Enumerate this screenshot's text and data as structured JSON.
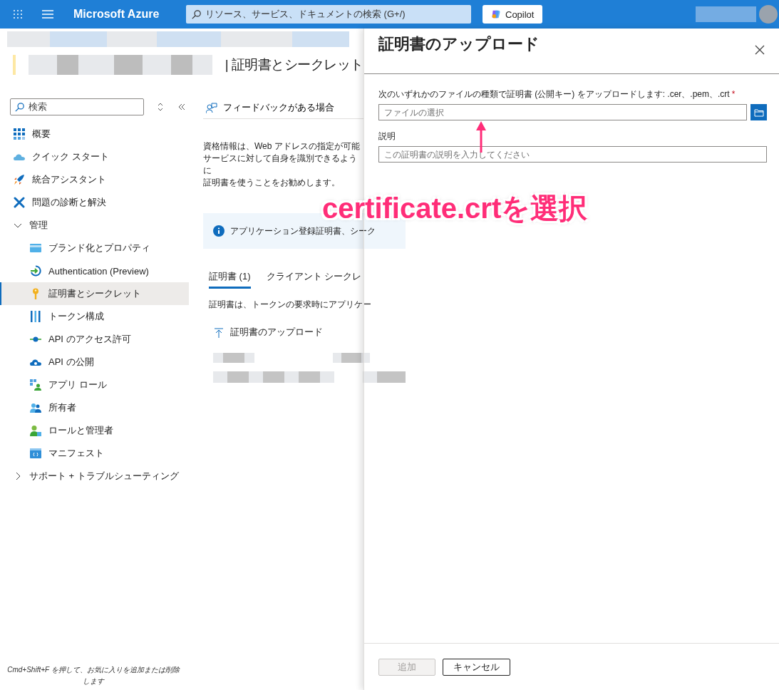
{
  "top_bar": {
    "title": "Microsoft Azure",
    "search": {
      "placeholder": "リソース、サービス、ドキュメントの検索 (G+/)"
    },
    "copilot_button": "Copilot"
  },
  "page": {
    "title": "| 証明書とシークレット",
    "sidebar": {
      "search": {
        "placeholder": "検索"
      },
      "items": [
        {
          "label": "概要",
          "selected": false
        },
        {
          "label": "クイック スタート",
          "selected": false
        },
        {
          "label": "統合アシスタント",
          "selected": false
        },
        {
          "label": "問題の診断と解決",
          "selected": false
        },
        {
          "label": "管理",
          "selected": false,
          "expanded": true,
          "children": [
            {
              "label": "ブランド化とプロパティ",
              "selected": false
            },
            {
              "label": "Authentication (Preview)",
              "selected": false
            },
            {
              "label": "証明書とシークレット",
              "selected": true
            },
            {
              "label": "トークン構成",
              "selected": false
            },
            {
              "label": "API のアクセス許可",
              "selected": false
            },
            {
              "label": "API の公開",
              "selected": false
            },
            {
              "label": "アプリ ロール",
              "selected": false
            },
            {
              "label": "所有者",
              "selected": false
            },
            {
              "label": "ロールと管理者",
              "selected": false
            },
            {
              "label": "マニフェスト",
              "selected": false
            }
          ]
        },
        {
          "label": "サポート + トラブルシューティング",
          "selected": false,
          "expanded": false
        }
      ],
      "hint": "Cmd+Shift+F を押して、お気に入りを追加または削除します"
    },
    "feedback": "フィードバックがある場合",
    "description": [
      "資格情報は、Web アドレスの指定が可能",
      "サービスに対して自身を識別できるように",
      "証明書を使うことをお勧めします。"
    ],
    "info": "アプリケーション登録証明書、シーク",
    "tabs": [
      {
        "label": "証明書 (1)",
        "selected": true
      },
      {
        "label": "クライアント シークレ",
        "selected": false
      }
    ],
    "tab_description": "証明書は、トークンの要求時にアプリケー",
    "upload_button": "証明書のアップロード"
  },
  "blade": {
    "title": "証明書のアップロード",
    "file_field": {
      "label": "次のいずれかのファイルの種類で証明書 (公開キー) をアップロードします: .cer、.pem、.crt",
      "required_mark": "*",
      "placeholder": "ファイルの選択"
    },
    "description_field": {
      "label": "説明",
      "placeholder": "この証明書の説明を入力してください"
    },
    "buttons": [
      {
        "label": "追加",
        "disabled": true
      },
      {
        "label": "キャンセル",
        "disabled": false
      }
    ]
  },
  "annotation": {
    "text": "certificate.crtを選択"
  }
}
